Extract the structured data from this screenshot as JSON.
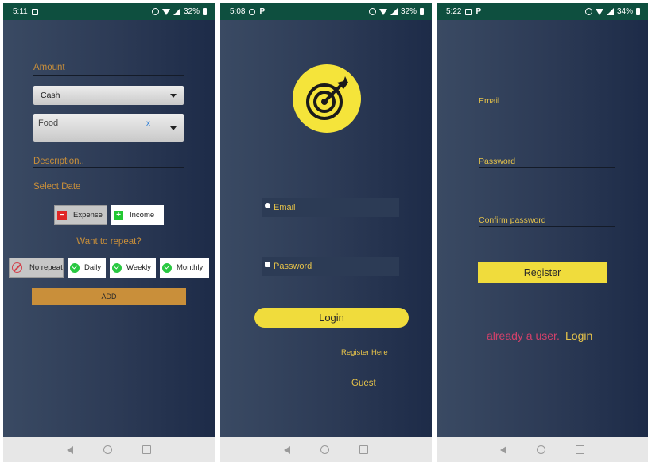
{
  "screens": [
    {
      "status": {
        "time": "5:11",
        "battery": "32%"
      },
      "form": {
        "amount_placeholder": "Amount",
        "account_value": "Cash",
        "category_value": "Food",
        "category_clear": "x",
        "description_placeholder": "Description..",
        "select_date": "Select Date",
        "type_buttons": {
          "expense": "Expense",
          "income": "Income",
          "expense_icon": "−",
          "income_icon": "+"
        },
        "repeat_prompt": "Want to repeat?",
        "repeat_options": {
          "no_repeat": "No repeat",
          "daily": "Daily",
          "weekly": "Weekly",
          "monthly": "Monthly"
        },
        "add_label": "ADD"
      }
    },
    {
      "status": {
        "time": "5:08",
        "app_icon": "P",
        "battery": "32%"
      },
      "login": {
        "email_placeholder": "Email",
        "password_placeholder": "Password",
        "login_label": "Login",
        "register_link": "Register Here",
        "guest_link": "Guest"
      }
    },
    {
      "status": {
        "time": "5:22",
        "app_icon": "P",
        "battery": "34%"
      },
      "register": {
        "email_placeholder": "Email",
        "password_placeholder": "Password",
        "confirm_placeholder": "Confirm password",
        "register_label": "Register",
        "already_user": "already a user.",
        "login_link": "Login"
      }
    }
  ],
  "icons": [
    "image-icon",
    "whatsapp-icon",
    "vibrate-icon",
    "wifi-icon",
    "signal-icon",
    "battery-icon",
    "target-icon",
    "user-icon",
    "lock-icon",
    "check-icon",
    "no-entry-icon",
    "dropdown-caret-icon",
    "back-icon",
    "home-icon",
    "recents-icon"
  ],
  "colors": {
    "status_bar": "#0e4f3f",
    "accent_orange": "#c98f3a",
    "add_button": "#c98f3a",
    "yellow": "#f0dc3c",
    "gold_text": "#e6c34a",
    "pink_text": "#d2416a",
    "check_green": "#28c840",
    "expense_red": "#e02525",
    "income_green": "#22c832"
  }
}
